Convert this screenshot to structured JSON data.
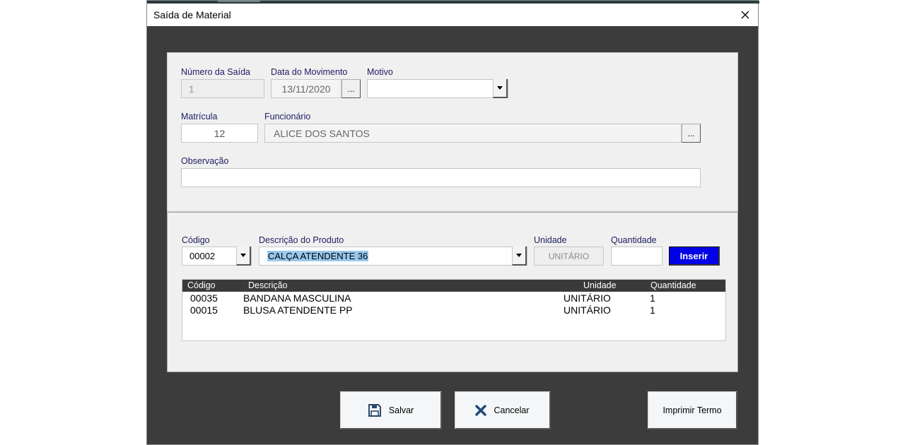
{
  "window": {
    "title": "Saída de Material"
  },
  "header": {
    "numero_saida": {
      "label": "Número da Saída",
      "value": "1"
    },
    "data_movimento": {
      "label": "Data do Movimento",
      "value": "13/11/2020",
      "picker_label": "..."
    },
    "motivo": {
      "label": "Motivo",
      "value": ""
    },
    "matricula": {
      "label": "Matrícula",
      "value": "12"
    },
    "funcionario": {
      "label": "Funcionário",
      "value": "ALICE DOS SANTOS",
      "picker_label": "..."
    },
    "observacao": {
      "label": "Observação",
      "value": ""
    }
  },
  "item_entry": {
    "codigo": {
      "label": "Código",
      "value": "00002"
    },
    "descricao": {
      "label": "Descrição do Produto",
      "value": "CALÇA ATENDENTE 36"
    },
    "unidade": {
      "label": "Unidade",
      "value": "UNITÁRIO"
    },
    "quantidade": {
      "label": "Quantidade",
      "value": ""
    },
    "inserir_label": "Inserir"
  },
  "items_list": {
    "columns": [
      "Código",
      "Descrição",
      "Unidade",
      "Quantidade"
    ],
    "rows": [
      {
        "codigo": "00035",
        "descricao": "BANDANA MASCULINA",
        "unidade": "UNITÁRIO",
        "quantidade": "1"
      },
      {
        "codigo": "00015",
        "descricao": "BLUSA ATENDENTE PP",
        "unidade": "UNITÁRIO",
        "quantidade": "1"
      }
    ]
  },
  "actions": {
    "salvar_label": "Salvar",
    "cancelar_label": "Cancelar",
    "imprimir_label": "Imprimir Termo"
  },
  "icons": {
    "close": "close-icon",
    "save": "floppy-disk-icon",
    "cancel": "x-mark-icon",
    "dropdown": "caret-down-icon"
  },
  "colors": {
    "label_text": "#1c1c63",
    "window_bg": "#3c3c3c",
    "panel_bg": "#f0f0f0",
    "inserir_bg": "#0000e6",
    "selection_highlight": "#99c9ef",
    "save_icon": "#2b4a6b",
    "cancel_icon": "#1f4a7a"
  }
}
